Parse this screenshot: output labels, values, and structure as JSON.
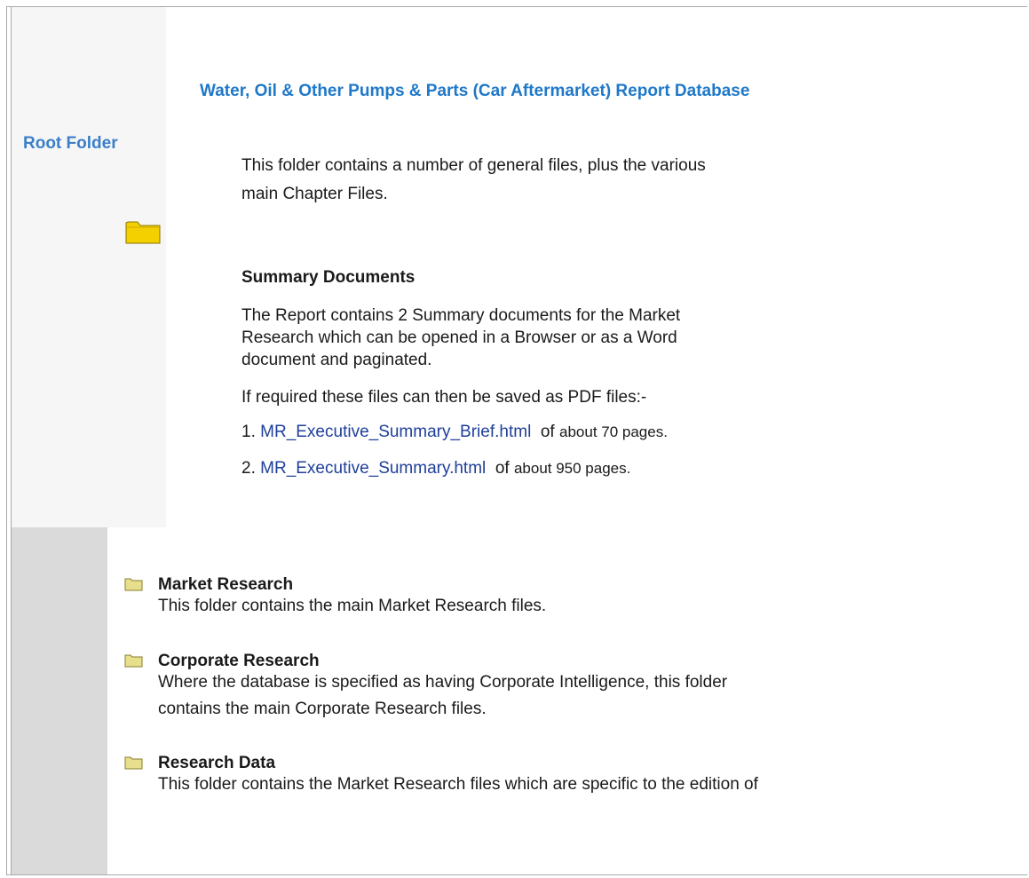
{
  "sidebar": {
    "root_label": "Root Folder"
  },
  "header": {
    "title": "Water, Oil & Other Pumps & Parts (Car Aftermarket) Report Database"
  },
  "intro": {
    "line1": "This folder contains a number of general files, plus the various",
    "line2": "main Chapter Files."
  },
  "summary": {
    "heading": "Summary Documents",
    "para_line1": "The Report contains 2 Summary documents for the Market",
    "para_line2": "Research which can be opened in a Browser or as a Word",
    "para_line3": "document and paginated.",
    "pdf_note": "If required these files can then be saved as PDF files:-",
    "items": [
      {
        "num": "1.",
        "link": "MR_Executive_Summary_Brief.html",
        "of": "of",
        "pages": "about 70 pages."
      },
      {
        "num": "2.",
        "link": "MR_Executive_Summary.html",
        "of": "of",
        "pages": "about 950 pages."
      }
    ]
  },
  "folders": [
    {
      "title": "Market Research",
      "desc": [
        "This folder contains the main Market Research files."
      ]
    },
    {
      "title": "Corporate Research",
      "desc": [
        "Where the database is specified as having Corporate Intelligence, this folder",
        "contains the main Corporate Research files."
      ]
    },
    {
      "title": "Research Data",
      "desc": [
        "This folder contains the Market Research files which are specific to the edition of"
      ]
    }
  ],
  "colors": {
    "title_blue": "#1f78c8",
    "link_blue": "#1f3f9a",
    "folder_yellow": "#f5d000",
    "sidebar_gray": "#dadada"
  },
  "icons": {
    "root": "folder-icon",
    "sections": "folder-icon"
  }
}
